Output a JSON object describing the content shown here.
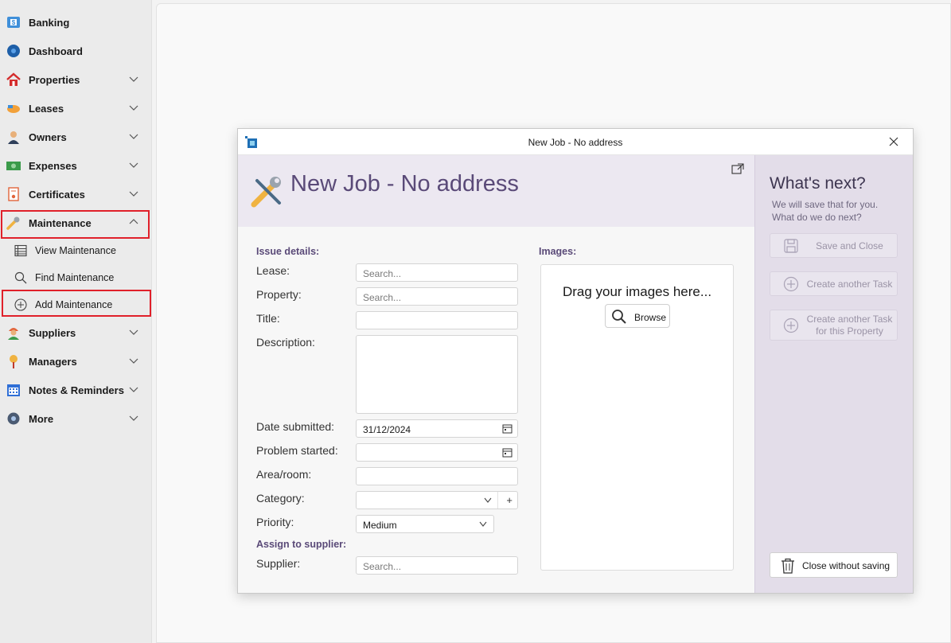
{
  "sidebar": {
    "items": [
      {
        "label": "Banking",
        "icon": "bank-icon"
      },
      {
        "label": "Dashboard",
        "icon": "dashboard-icon"
      },
      {
        "label": "Properties",
        "icon": "house-icon"
      },
      {
        "label": "Leases",
        "icon": "handshake-icon"
      },
      {
        "label": "Owners",
        "icon": "person-icon"
      },
      {
        "label": "Expenses",
        "icon": "money-icon"
      },
      {
        "label": "Certificates",
        "icon": "certificate-icon"
      },
      {
        "label": "Maintenance",
        "icon": "wrench-icon"
      },
      {
        "label": "Suppliers",
        "icon": "worker-icon"
      },
      {
        "label": "Managers",
        "icon": "pin-icon"
      },
      {
        "label": "Notes & Reminders",
        "icon": "calendar-icon"
      },
      {
        "label": "More",
        "icon": "gear-icon"
      }
    ],
    "maintenance_sub": [
      {
        "label": "View Maintenance",
        "icon": "list-icon"
      },
      {
        "label": "Find Maintenance",
        "icon": "search-icon"
      },
      {
        "label": "Add Maintenance",
        "icon": "add-circle-icon"
      }
    ]
  },
  "dialog": {
    "window_title": "New Job - No address",
    "heading": "New Job - No address",
    "issue_details_label": "Issue details:",
    "images_label": "Images:",
    "assign_label": "Assign to supplier:",
    "fields": {
      "lease_label": "Lease:",
      "lease_placeholder": "Search...",
      "property_label": "Property:",
      "property_placeholder": "Search...",
      "title_label": "Title:",
      "description_label": "Description:",
      "date_submitted_label": "Date submitted:",
      "date_submitted_value": "31/12/2024",
      "problem_started_label": "Problem started:",
      "area_label": "Area/room:",
      "category_label": "Category:",
      "priority_label": "Priority:",
      "priority_value": "Medium",
      "supplier_label": "Supplier:",
      "supplier_placeholder": "Search..."
    },
    "images": {
      "drag_text": "Drag your images here...",
      "browse_label": "Browse"
    },
    "whats_next": {
      "title": "What's next?",
      "subtitle_line1": "We will save that for you.",
      "subtitle_line2": "What do we do next?",
      "save_close": "Save and Close",
      "create_task": "Create another Task",
      "create_task_property_l1": "Create another Task",
      "create_task_property_l2": "for this Property",
      "close_without_saving": "Close without saving"
    }
  },
  "colors": {
    "accent": "#5a4a78",
    "highlight": "#e0202a",
    "panel": "#e3dde9"
  }
}
